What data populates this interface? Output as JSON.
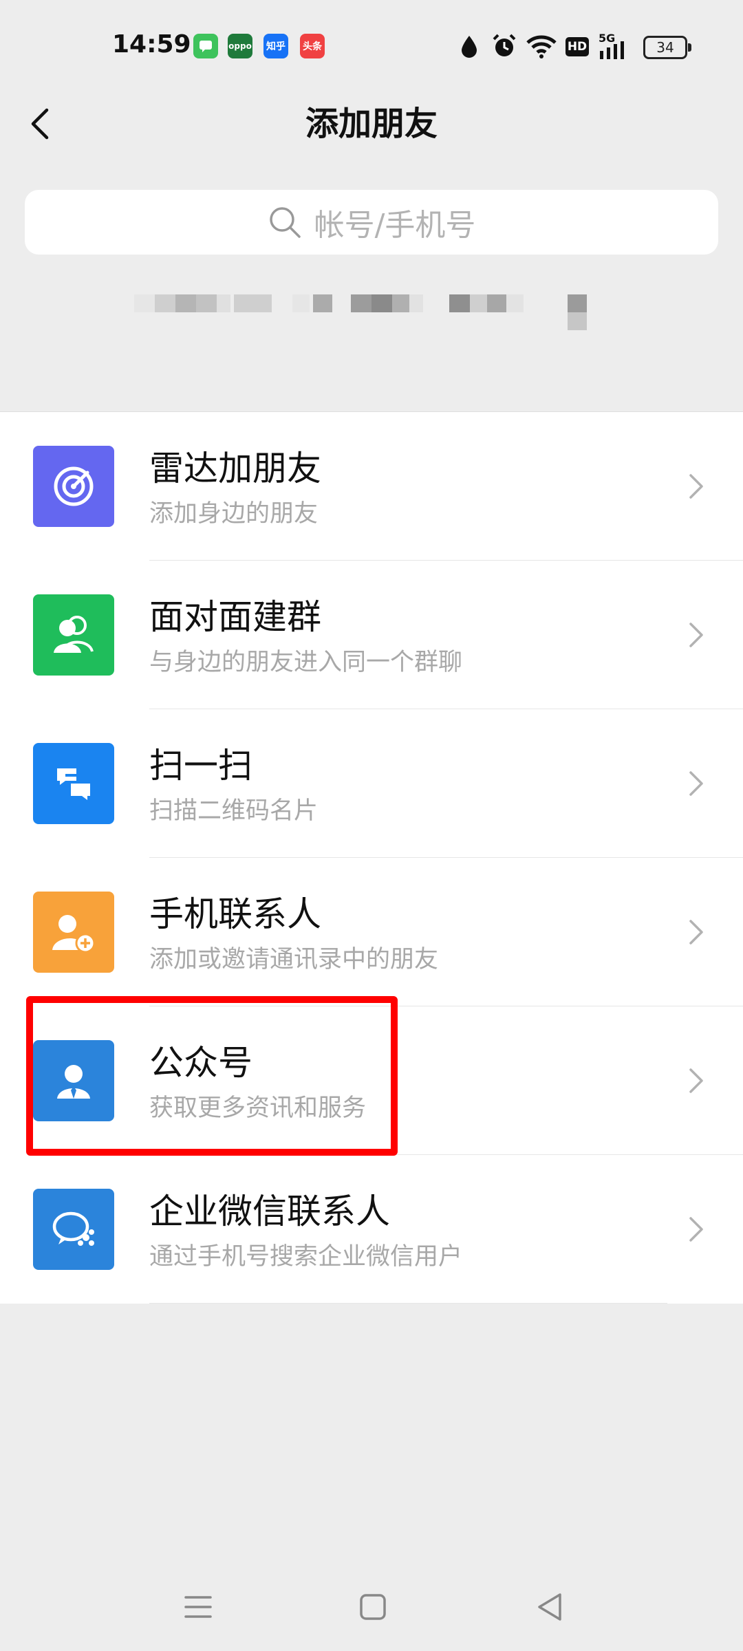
{
  "status_bar": {
    "time": "14:59",
    "notifications": [
      {
        "name": "message-app-icon",
        "label": ""
      },
      {
        "name": "oppo-app-icon",
        "label": "oppo"
      },
      {
        "name": "zhihu-app-icon",
        "label": "知乎"
      },
      {
        "name": "toutiao-app-icon",
        "label": "头条"
      }
    ],
    "network_label": "5G",
    "hd_label": "HD",
    "battery": "34"
  },
  "header": {
    "title": "添加朋友"
  },
  "search": {
    "placeholder": "帐号/手机号"
  },
  "items": [
    {
      "title": "雷达加朋友",
      "subtitle": "添加身边的朋友",
      "color": "#6467f0",
      "icon": "radar-icon"
    },
    {
      "title": "面对面建群",
      "subtitle": "与身边的朋友进入同一个群聊",
      "color": "#1fbd5b",
      "icon": "group-icon"
    },
    {
      "title": "扫一扫",
      "subtitle": "扫描二维码名片",
      "color": "#1a84f0",
      "icon": "scan-icon"
    },
    {
      "title": "手机联系人",
      "subtitle": "添加或邀请通讯录中的朋友",
      "color": "#f8a23a",
      "icon": "add-contact-icon"
    },
    {
      "title": "公众号",
      "subtitle": "获取更多资讯和服务",
      "color": "#2b84db",
      "icon": "official-account-icon"
    },
    {
      "title": "企业微信联系人",
      "subtitle": "通过手机号搜索企业微信用户",
      "color": "#2b84db",
      "icon": "wecom-icon"
    }
  ],
  "colors": {
    "background": "#ededed",
    "highlight": "#ff0000"
  }
}
